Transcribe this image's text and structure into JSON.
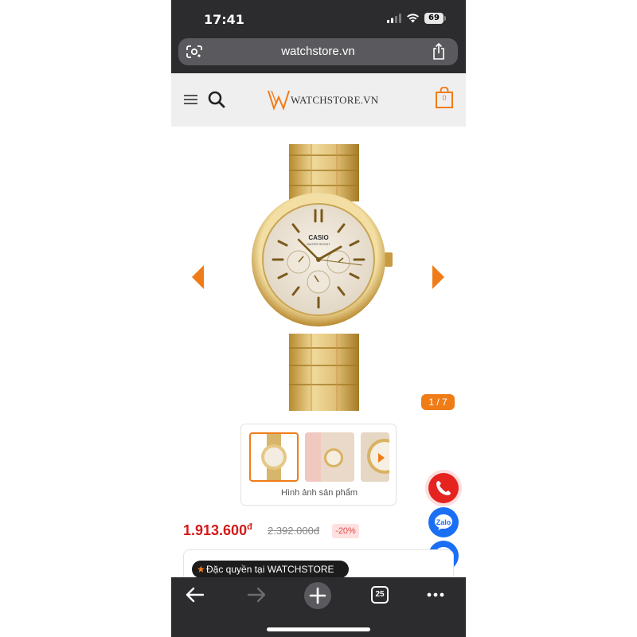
{
  "status_bar": {
    "time": "17:41",
    "battery_level": "69",
    "icons": [
      "cellular-signal-icon",
      "wifi-icon",
      "battery-icon"
    ]
  },
  "browser": {
    "url": "watchstore.vn",
    "icons": [
      "google-lens-icon",
      "share-icon"
    ]
  },
  "site_header": {
    "logo_text": "WATCHSTORE.VN",
    "cart_count": "0",
    "icons": [
      "hamburger-menu-icon",
      "search-icon",
      "watchstore-logo-icon",
      "shopping-bag-icon"
    ]
  },
  "gallery": {
    "counter": "1 / 7",
    "thumbnail_caption": "Hình ảnh sản phẩm",
    "icons": [
      "previous-arrow-icon",
      "next-arrow-icon",
      "thumbnail-next-icon"
    ]
  },
  "product": {
    "price": "1.913.600",
    "price_currency": "đ",
    "old_price": "2.392.000đ",
    "discount": "-20%",
    "privilege_label": "Đặc quyền tại WATCHSTORE"
  },
  "contact_buttons": {
    "zalo_label": "Zalo",
    "icons": [
      "phone-icon",
      "zalo-icon",
      "messenger-icon"
    ]
  },
  "toolbar": {
    "tab_count": "25",
    "icons": [
      "back-arrow-icon",
      "forward-arrow-icon",
      "new-tab-icon",
      "tabs-icon",
      "more-icon"
    ]
  },
  "colors": {
    "accent": "#f07c18",
    "price_red": "#d41a1a",
    "browser_chrome": "#2c2c2e",
    "call_red": "#e5231f",
    "social_blue": "#1b6ff5"
  }
}
